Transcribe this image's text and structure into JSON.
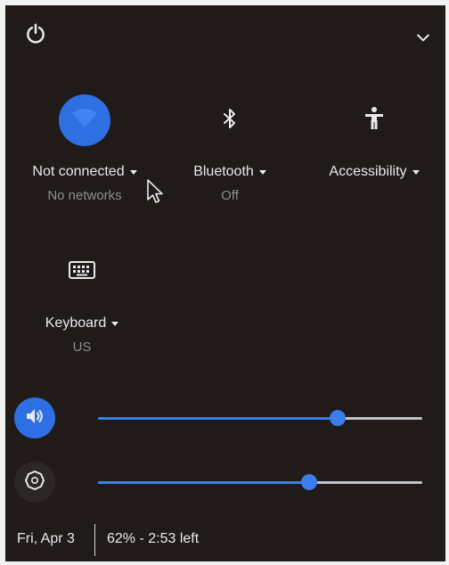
{
  "header": {
    "power_icon": "power-icon",
    "collapse_icon": "chevron-down-icon"
  },
  "tiles": [
    {
      "key": "network",
      "icon": "wifi-icon",
      "active": true,
      "label": "Not connected",
      "sublabel": "No networks"
    },
    {
      "key": "bluetooth",
      "icon": "bluetooth-icon",
      "active": false,
      "label": "Bluetooth",
      "sublabel": "Off"
    },
    {
      "key": "accessibility",
      "icon": "accessibility-icon",
      "active": false,
      "label": "Accessibility",
      "sublabel": ""
    },
    {
      "key": "keyboard",
      "icon": "keyboard-icon",
      "active": false,
      "label": "Keyboard",
      "sublabel": "US"
    }
  ],
  "sliders": {
    "volume": {
      "icon": "volume-icon",
      "level": 0.74
    },
    "brightness": {
      "icon": "brightness-icon",
      "level": 0.65
    }
  },
  "footer": {
    "date": "Fri, Apr 3",
    "battery": "62% - 2:53 left"
  },
  "colors": {
    "accent": "#2f6fe4",
    "panel_bg": "#201a18",
    "text": "#e8eaed",
    "subtext": "#8f8f8f"
  }
}
